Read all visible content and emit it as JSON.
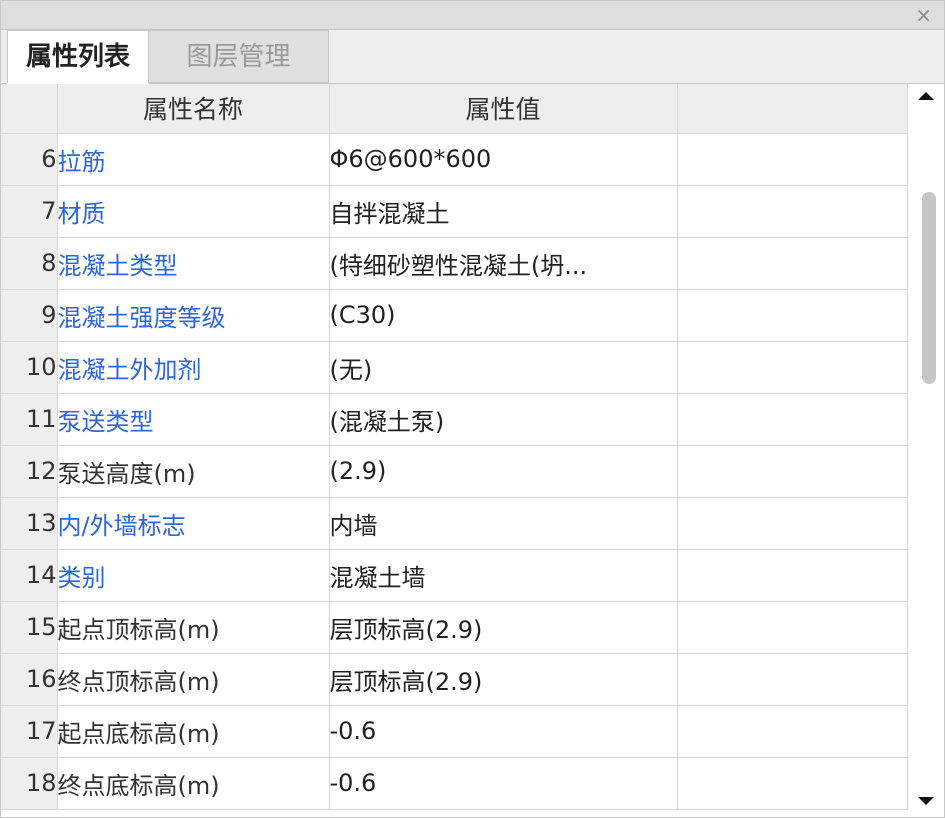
{
  "window": {
    "close_glyph": "×"
  },
  "tabs": [
    {
      "label": "属性列表",
      "active": true
    },
    {
      "label": "图层管理",
      "active": false
    }
  ],
  "table": {
    "headers": {
      "name": "属性名称",
      "value": "属性值"
    },
    "rows": [
      {
        "num": "6",
        "name": "拉筋",
        "value": "Φ6@600*600",
        "linked": true
      },
      {
        "num": "7",
        "name": "材质",
        "value": "自拌混凝土",
        "linked": true
      },
      {
        "num": "8",
        "name": "混凝土类型",
        "value": "(特细砂塑性混凝土(坍...",
        "linked": true
      },
      {
        "num": "9",
        "name": "混凝土强度等级",
        "value": "(C30)",
        "linked": true
      },
      {
        "num": "10",
        "name": "混凝土外加剂",
        "value": "(无)",
        "linked": true
      },
      {
        "num": "11",
        "name": "泵送类型",
        "value": "(混凝土泵)",
        "linked": true
      },
      {
        "num": "12",
        "name": "泵送高度(m)",
        "value": "(2.9)",
        "linked": false
      },
      {
        "num": "13",
        "name": "内/外墙标志",
        "value": "内墙",
        "linked": true
      },
      {
        "num": "14",
        "name": "类别",
        "value": "混凝土墙",
        "linked": true
      },
      {
        "num": "15",
        "name": "起点顶标高(m)",
        "value": "层顶标高(2.9)",
        "linked": false
      },
      {
        "num": "16",
        "name": "终点顶标高(m)",
        "value": "层顶标高(2.9)",
        "linked": false
      },
      {
        "num": "17",
        "name": "起点底标高(m)",
        "value": "-0.6",
        "linked": false
      },
      {
        "num": "18",
        "name": "终点底标高(m)",
        "value": "-0.6",
        "linked": false
      }
    ]
  },
  "colors": {
    "link": "#2f66d6",
    "header_selected": "#7ab8f5"
  }
}
